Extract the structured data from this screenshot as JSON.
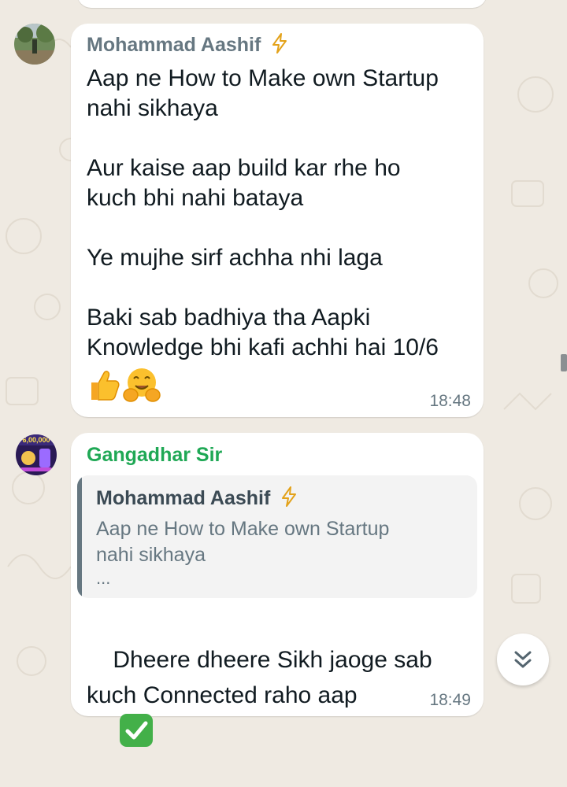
{
  "messages": [
    {
      "sender": "Mohammad Aashif",
      "sender_color": "#667781",
      "text": "Aap ne How to Make own Startup\nnahi sikhaya\n\nAur kaise aap build kar rhe ho\nkuch bhi nahi bataya\n\nYe mujhe sirf achha nhi laga\n\nBaki sab badhiya tha Aapki\nKnowledge bhi kafi achhi hai 10/6",
      "emojis": [
        "thumbs-up",
        "hugging-face"
      ],
      "time": "18:48"
    },
    {
      "sender": "Gangadhar Sir",
      "sender_color": "#1fa855",
      "avatar_text": "6,00,000",
      "quote": {
        "sender": "Mohammad Aashif",
        "text": "Aap ne How to Make own Startup\nnahi sikhaya",
        "more": "..."
      },
      "text": "Dheere dheere Sikh jaoge sab\nkuch Connected raho aap",
      "emojis": [
        "check-mark-button"
      ],
      "time": "18:49"
    }
  ],
  "icons": {
    "scroll_down": "double-chevron-down-icon",
    "sender_badge": "lightning-bolt-icon"
  },
  "colors": {
    "wallpaper": "#efeae2",
    "bubble": "#ffffff",
    "time": "#667781",
    "quote_bg": "#f3f3f3"
  }
}
